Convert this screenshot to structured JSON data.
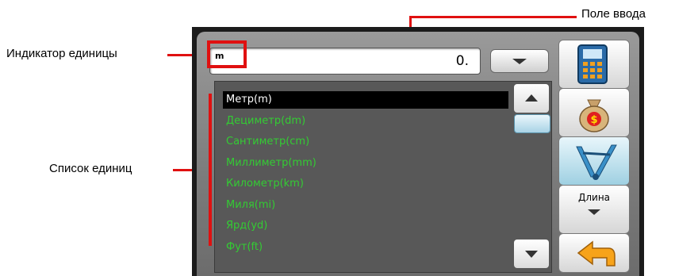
{
  "annotations": {
    "input_field": "Поле ввода",
    "unit_indicator": "Индикатор единицы",
    "unit_list": "Список единиц"
  },
  "input": {
    "unit_indicator": "m",
    "value": "0."
  },
  "units": [
    {
      "label": "Метр(m)",
      "selected": true
    },
    {
      "label": "Дециметр(dm)",
      "selected": false
    },
    {
      "label": "Сантиметр(cm)",
      "selected": false
    },
    {
      "label": "Миллиметр(mm)",
      "selected": false
    },
    {
      "label": "Километр(km)",
      "selected": false
    },
    {
      "label": "Миля(mi)",
      "selected": false
    },
    {
      "label": "Ярд(yd)",
      "selected": false
    },
    {
      "label": "Фут(ft)",
      "selected": false
    }
  ],
  "sidebar": {
    "category_label": "Длина",
    "icons": [
      "calculator-icon",
      "money-bag-icon",
      "ruler-icon",
      "back-arrow-icon"
    ]
  },
  "colors": {
    "annotation_red": "#e01010",
    "unit_text": "#33cc33",
    "selected_bg": "#000000"
  }
}
